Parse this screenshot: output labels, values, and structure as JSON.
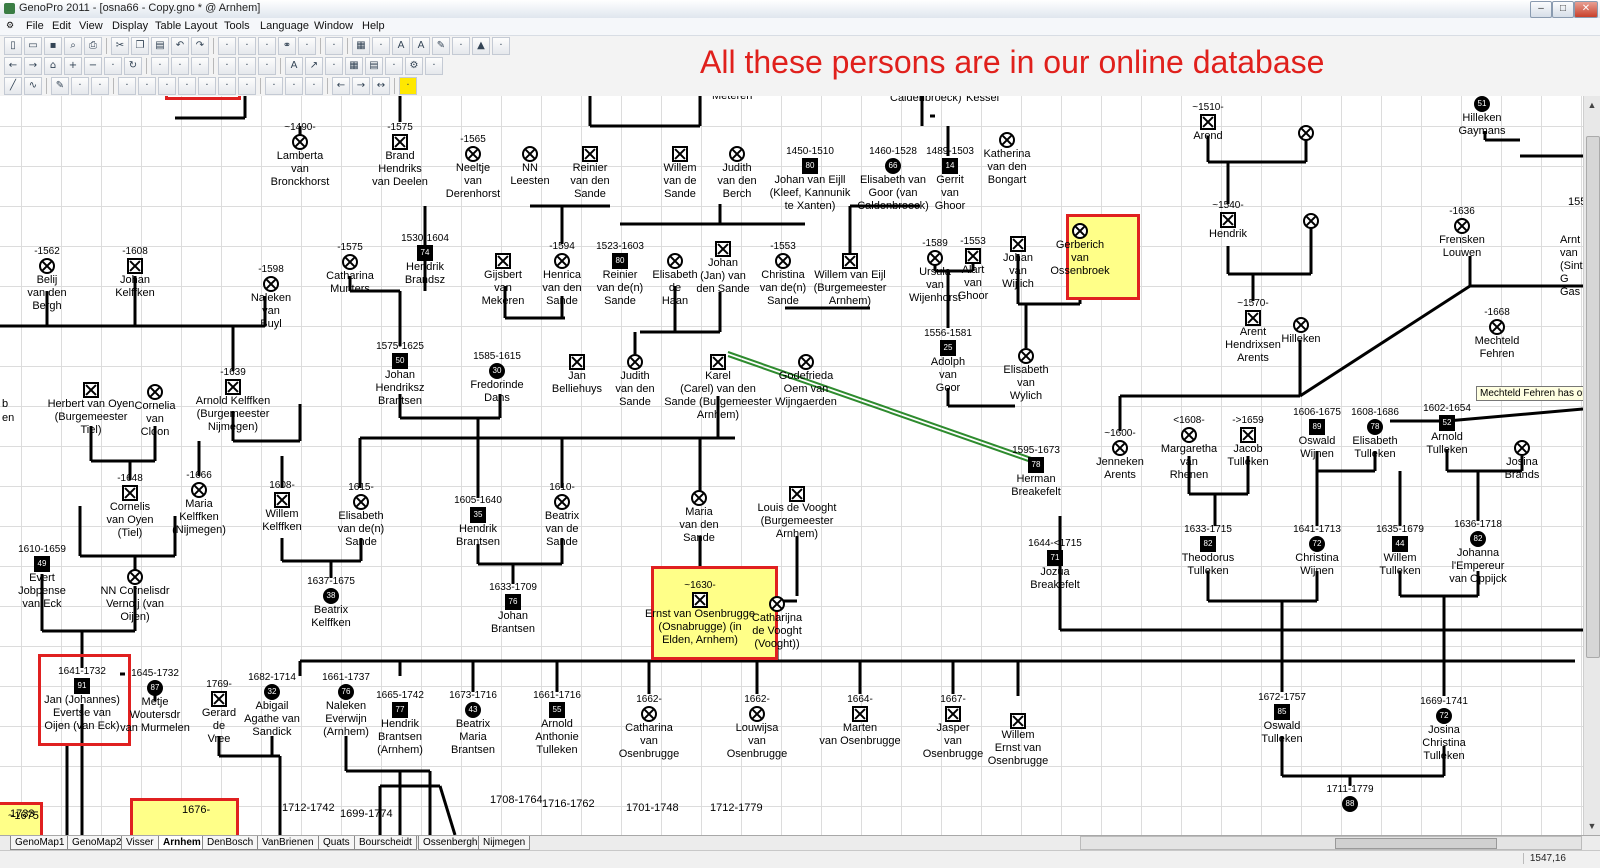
{
  "window": {
    "title": "GenoPro 2011 - [osna66 - Copy.gno * @ Arnhem]",
    "min_icon": "minimize-icon",
    "max_icon": "maximize-icon",
    "close_icon": "close-icon"
  },
  "menu": [
    "File",
    "Edit",
    "View",
    "Display",
    "Table Layout",
    "Tools",
    "Language",
    "Window",
    "Help"
  ],
  "toolbar_icons": {
    "row1": [
      "new-icon",
      "open-icon",
      "save-icon",
      "print-preview-icon",
      "print-icon",
      "sep",
      "cut-icon",
      "copy-icon",
      "paste-icon",
      "undo-icon",
      "redo-icon",
      "sep",
      "add-individual-icon",
      "add-family-icon",
      "add-pet-icon",
      "link-icon",
      "unlink-icon",
      "sep",
      "tree-icon",
      "sep",
      "grid-icon",
      "picture-icon",
      "text-icon",
      "font-icon",
      "pen-icon",
      "fill-icon",
      "triangle-icon",
      "paint-icon"
    ],
    "row2": [
      "back-icon",
      "forward-icon",
      "home-icon",
      "zoom-in-icon",
      "zoom-out-icon",
      "zoom-fit-icon",
      "refresh-icon",
      "sep",
      "select-icon",
      "lasso-icon",
      "move-icon",
      "sep",
      "align-left-icon",
      "align-center-icon",
      "align-right-icon",
      "sep",
      "text-icon",
      "arrow-icon",
      "hatch-icon",
      "grid-icon",
      "table-icon",
      "folder-icon",
      "gear-icon",
      "tag-icon"
    ],
    "row3": [
      "line-icon",
      "curve-icon",
      "sep",
      "pen-icon",
      "double-line-icon",
      "dash-icon",
      "sep",
      "box-1-icon",
      "box-2-icon",
      "box-3-icon",
      "box-4-icon",
      "box-5-icon",
      "box-6-icon",
      "box-7-icon",
      "sep",
      "line-thin-icon",
      "line-medium-icon",
      "line-thick-icon",
      "sep",
      "arrow-left-icon",
      "arrow-right-icon",
      "arrow-double-icon",
      "sep",
      "square-yellow-icon"
    ]
  },
  "banner": "All these persons are in our online database",
  "tooltip": "Mechteld Fehren has one child",
  "colors": {
    "banner": "#e0201c",
    "highlight_fill": "#ffff88",
    "highlight_border": "#e02020",
    "marriage_link": "#2e8b2e",
    "grid": "#dcdcdc"
  },
  "persons": [
    {
      "years": "~1490-",
      "name": "Lamberta\nvan\nBronckhorst",
      "sym": "f-x"
    },
    {
      "years": "-1575",
      "name": "Brand\nHendriks\nvan Deelen",
      "sym": "m-x"
    },
    {
      "years": "-1565",
      "name": "Neeltje\nvan\nDerenhorst",
      "sym": "f-x"
    },
    {
      "years": "",
      "name": "NN\nLeesten",
      "sym": "f-x"
    },
    {
      "years": "",
      "name": "Reinier\nvan den\nSande",
      "sym": "m-x"
    },
    {
      "years": "",
      "name": "Willem\nvan de\nSande",
      "sym": "m-x"
    },
    {
      "years": "",
      "name": "Judith\nvan den\nBerch",
      "sym": "f-x"
    },
    {
      "years": "1450-1510",
      "name": "Johan van Eijll\n(Kleef, Kannunik\nte Xanten)",
      "sym": "m-80"
    },
    {
      "years": "1460-1528",
      "name": "Elisabeth van\nGoor (van\nCaldenbroeck)",
      "sym": "f-66"
    },
    {
      "years": "1489-1503",
      "name": "Gerrit\nvan\nGhoor",
      "sym": "m-14"
    },
    {
      "years": "",
      "name": "Katherina\nvan den\nBongart",
      "sym": "f-x"
    },
    {
      "years": "-1562",
      "name": "Belij\nvan den\nBergh",
      "sym": "f-x"
    },
    {
      "years": "-1608",
      "name": "Johan\nKelffken",
      "sym": "m-x"
    },
    {
      "years": "-1598",
      "name": "Naleken\nvan\nBuyl",
      "sym": "f-x"
    },
    {
      "years": "-1575",
      "name": "Catharina\nMunters",
      "sym": "f-x"
    },
    {
      "years": "1530-1604",
      "name": "Hendrik\nBrandsz",
      "sym": "m-74"
    },
    {
      "years": "",
      "name": "Gijsbert\nvan\nMekeren",
      "sym": "m-x"
    },
    {
      "years": "-1594",
      "name": "Henrica\nvan den\nSande",
      "sym": "f-x"
    },
    {
      "years": "1523-1603",
      "name": "Reinier\nvan de(n)\nSande",
      "sym": "m-80"
    },
    {
      "years": "",
      "name": "Elisabeth\nde\nHaan",
      "sym": "f-x"
    },
    {
      "years": "",
      "name": "Johan\n(Jan) van\nden Sande",
      "sym": "m-x"
    },
    {
      "years": "-1553",
      "name": "Christina\nvan de(n)\nSande",
      "sym": "f-x"
    },
    {
      "years": "",
      "name": "Willem van Eijl\n(Burgemeester\nArnhem)",
      "sym": "m-x"
    },
    {
      "years": "-1589",
      "name": "Ursula\nvan\nWijenhorst",
      "sym": "f-x"
    },
    {
      "years": "-1553",
      "name": "Alart\nvan\nGhoor",
      "sym": "m-x"
    },
    {
      "years": "",
      "name": "Johan\nvan\nWijlich",
      "sym": "m-x"
    },
    {
      "years": "",
      "name": "Gerberich\nvan\nOssenbroek",
      "sym": "f-x"
    },
    {
      "years": "1575-1625",
      "name": "Johan\nHendriksz\nBrantsen",
      "sym": "m-50"
    },
    {
      "years": "1585-1615",
      "name": "Fredorinde\nDans",
      "sym": "f-30"
    },
    {
      "years": "",
      "name": "Jan\nBelliehuys",
      "sym": "m-x"
    },
    {
      "years": "",
      "name": "Judith\nvan den\nSande",
      "sym": "f-x"
    },
    {
      "years": "",
      "name": "Karel\n(Carel) van den\nSande (Burgemeester\nArnhem)",
      "sym": "m-x"
    },
    {
      "years": "",
      "name": "Godefrieda\nOem van\nWijngaerden",
      "sym": "f-x"
    },
    {
      "years": "1556-1581",
      "name": "Adolph\nvan\nGoor",
      "sym": "m-25"
    },
    {
      "years": "",
      "name": "Elisabeth\nvan\nWylich",
      "sym": "f-x"
    },
    {
      "years": "",
      "name": "Herbert van Oyen\n(Burgemeester\nTiel)",
      "sym": "m-x"
    },
    {
      "years": "",
      "name": "Cornelia\nvan\nCloon",
      "sym": "f-x"
    },
    {
      "years": "-1639",
      "name": "Arnold Kelffken\n(Burgemeester\nNijmegen)",
      "sym": "m-x"
    },
    {
      "years": "-1648",
      "name": "Cornelis\nvan Oyen\n(Tiel)",
      "sym": "m-x"
    },
    {
      "years": "-1666",
      "name": "Maria\nKelffken\n(Nijmegen)",
      "sym": "f-x"
    },
    {
      "years": "1608-",
      "name": "Willem\nKelffken",
      "sym": "m-x"
    },
    {
      "years": "1615-",
      "name": "Elisabeth\nvan de(n)\nSande",
      "sym": "f-x"
    },
    {
      "years": "1605-1640",
      "name": "Hendrik\nBrantsen",
      "sym": "m-35"
    },
    {
      "years": "1610-",
      "name": "Beatrix\nvan de\nSande",
      "sym": "f-x"
    },
    {
      "years": "",
      "name": "Maria\nvan den\nSande",
      "sym": "f-x"
    },
    {
      "years": "",
      "name": "Louis de Vooght\n(Burgemeester\nArnhem)",
      "sym": "m-x"
    },
    {
      "years": "1610-1659",
      "name": "Evert\nJobpense\nvan Eck",
      "sym": "m-49"
    },
    {
      "years": "",
      "name": "NN Cornelisdr\nVernoij (van\nOijen)",
      "sym": "f-x"
    },
    {
      "years": "1637-1675",
      "name": "Beatrix\nKelffken",
      "sym": "f-38"
    },
    {
      "years": "1633-1709",
      "name": "Johan\nBrantsen",
      "sym": "m-76"
    },
    {
      "years": "~1630-",
      "name": "Ernst van Osenbrugge\n(Osnabrugge) (in\nElden, Arnhem)",
      "sym": "m-x"
    },
    {
      "years": "",
      "name": "Catharijna\nde Vooght\n(Vooght))",
      "sym": "f-x"
    },
    {
      "years": "1641-1732",
      "name": "Jan (Johannes)\nEvertse van\nOijen (van Eck)",
      "sym": "m-91"
    },
    {
      "years": "1645-1732",
      "name": "Metje\nWoutersdr\nvan Murmelen",
      "sym": "f-87"
    },
    {
      "years": "1769-",
      "name": "Gerard\nde\nVree",
      "sym": "m-x"
    },
    {
      "years": "1682-1714",
      "name": "Abigail\nAgathe van\nSandick",
      "sym": "f-32"
    },
    {
      "years": "1661-1737",
      "name": "Naleken\nEverwijn\n(Arnhem)",
      "sym": "f-76"
    },
    {
      "years": "1665-1742",
      "name": "Hendrik\nBrantsen\n(Arnhem)",
      "sym": "m-77"
    },
    {
      "years": "1673-1716",
      "name": "Beatrix\nMaria\nBrantsen",
      "sym": "f-43"
    },
    {
      "years": "1661-1716",
      "name": "Arnold\nAnthonie\nTulleken",
      "sym": "m-55"
    },
    {
      "years": "1662-",
      "name": "Catharina\nvan\nOsenbrugge",
      "sym": "f-x"
    },
    {
      "years": "1662-",
      "name": "Louwijsa\nvan\nOsenbrugge",
      "sym": "f-x"
    },
    {
      "years": "1664-",
      "name": "Marten\nvan Osenbrugge",
      "sym": "m-x"
    },
    {
      "years": "1667-",
      "name": "Jasper\nvan\nOsenbrugge",
      "sym": "m-x"
    },
    {
      "years": "",
      "name": "Willem\nErnst van\nOsenbrugge",
      "sym": "m-x"
    },
    {
      "years": "~1510-",
      "name": "Arend",
      "sym": "m-x"
    },
    {
      "years": "",
      "name": "",
      "sym": "f-x"
    },
    {
      "years": "",
      "name": "Hilleken\nGaymans",
      "sym": "f-51"
    },
    {
      "years": "~1540-",
      "name": "Hendrik",
      "sym": "m-x"
    },
    {
      "years": "",
      "name": "",
      "sym": "f-x"
    },
    {
      "years": "-1636",
      "name": "Frensken\nLouwen",
      "sym": "f-x"
    },
    {
      "years": "~1570-",
      "name": "Arent\nHendrixsen\nArents",
      "sym": "m-x"
    },
    {
      "years": "",
      "name": "Hilleken",
      "sym": "f-x"
    },
    {
      "years": "-1668",
      "name": "Mechteld\nFehren",
      "sym": "f-x"
    },
    {
      "years": "1595-1673",
      "name": "Herman\nBreakefelt",
      "sym": "m-78"
    },
    {
      "years": "~1600-",
      "name": "Jenneken\nArents",
      "sym": "f-x"
    },
    {
      "years": "<1608-",
      "name": "Margaretha\nvan\nRhenen",
      "sym": "f-x"
    },
    {
      "years": "->1659",
      "name": "Jacob\nTulleken",
      "sym": "m-x"
    },
    {
      "years": "1606-1675",
      "name": "Oswald\nWijnen",
      "sym": "m-89"
    },
    {
      "years": "1608-1686",
      "name": "Elisabeth\nTulleken",
      "sym": "f-78"
    },
    {
      "years": "1602-1654",
      "name": "Arnold\nTulleken",
      "sym": "m-52"
    },
    {
      "years": "",
      "name": "Josina\nBrands",
      "sym": "f-x"
    },
    {
      "years": "1644-<1715",
      "name": "Jozua\nBreakefelt",
      "sym": "m-71"
    },
    {
      "years": "1633-1715",
      "name": "Theodorus\nTulleken",
      "sym": "m-82"
    },
    {
      "years": "1641-1713",
      "name": "Christina\nWijnen",
      "sym": "f-72"
    },
    {
      "years": "1635-1679",
      "name": "Willem\nTulleken",
      "sym": "m-44"
    },
    {
      "years": "1636-1718",
      "name": "Johanna\nl'Empereur\nvan Oppijck",
      "sym": "f-82"
    },
    {
      "years": "1672-1757",
      "name": "Oswald\nTulleken",
      "sym": "m-85"
    },
    {
      "years": "1669-1741",
      "name": "Josina\nChristina\nTulleken",
      "sym": "f-72"
    },
    {
      "years": "1711-1779",
      "name": "",
      "sym": "f-88"
    }
  ],
  "fragments": [
    "Caldenbroeck)",
    "Kessel",
    "Meteren",
    "~1675",
    "1676-",
    "1712-1742",
    "1699-1774",
    "1708-1764",
    "1716-1762",
    "1701-1748",
    "1712-1779",
    "1733",
    "Arnt\nvan\n(Sint G\nGas",
    "155",
    "b",
    "en"
  ],
  "tabs": [
    "GenoMap1",
    "GenoMap2",
    "Visser",
    "Arnhem",
    "DenBosch",
    "VanBrienen",
    "Quats",
    "Bourscheidt",
    "Ossenbergh",
    "Nijmegen"
  ],
  "active_tab": "Arnhem",
  "status": {
    "coords": "1547,16"
  }
}
